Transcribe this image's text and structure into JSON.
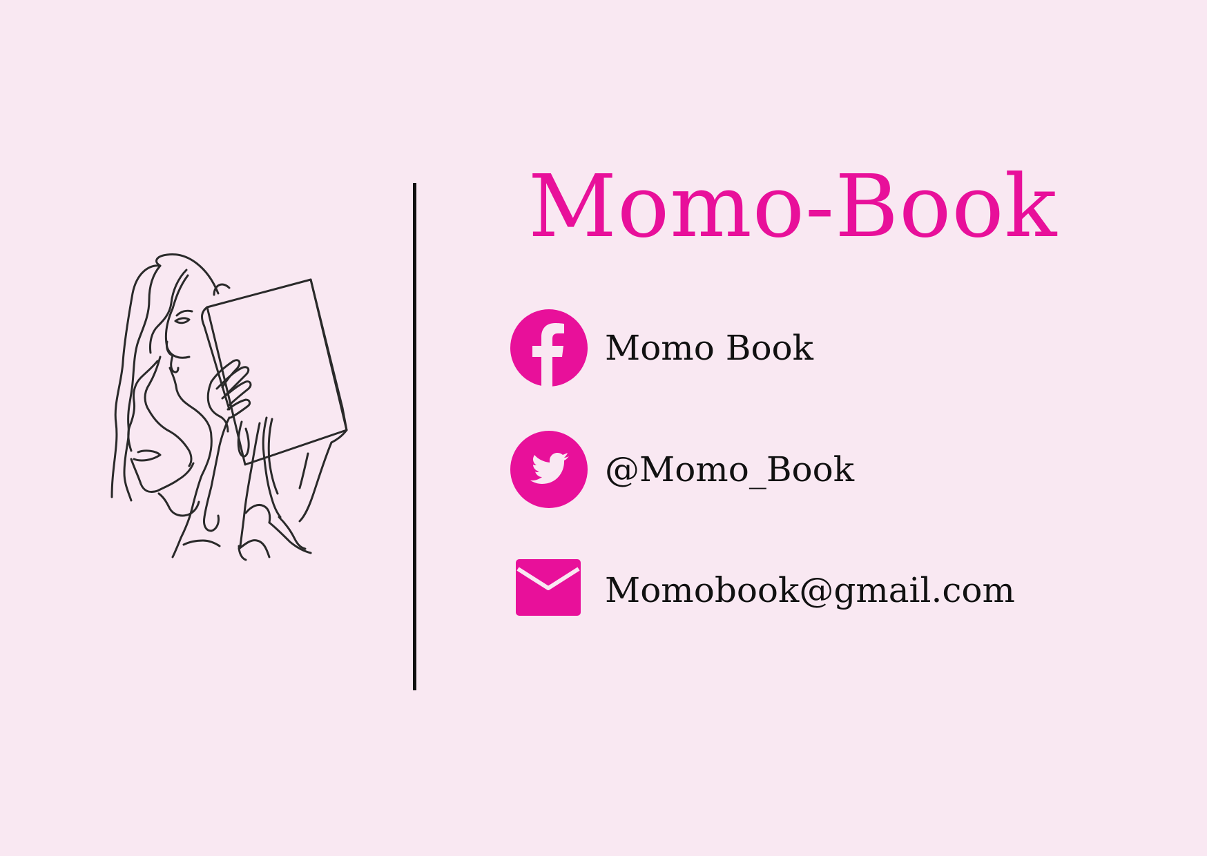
{
  "colors": {
    "background": "#f9e8f2",
    "accent": "#e8109a",
    "ink": "#111111"
  },
  "brand": {
    "title": "Momo-Book"
  },
  "illustration": {
    "icon": "woman-reading-book-line-art"
  },
  "contacts": [
    {
      "icon": "facebook-icon",
      "label": "Momo Book"
    },
    {
      "icon": "twitter-icon",
      "label": "@Momo_Book"
    },
    {
      "icon": "mail-icon",
      "label": "Momobook@gmail.com"
    }
  ]
}
